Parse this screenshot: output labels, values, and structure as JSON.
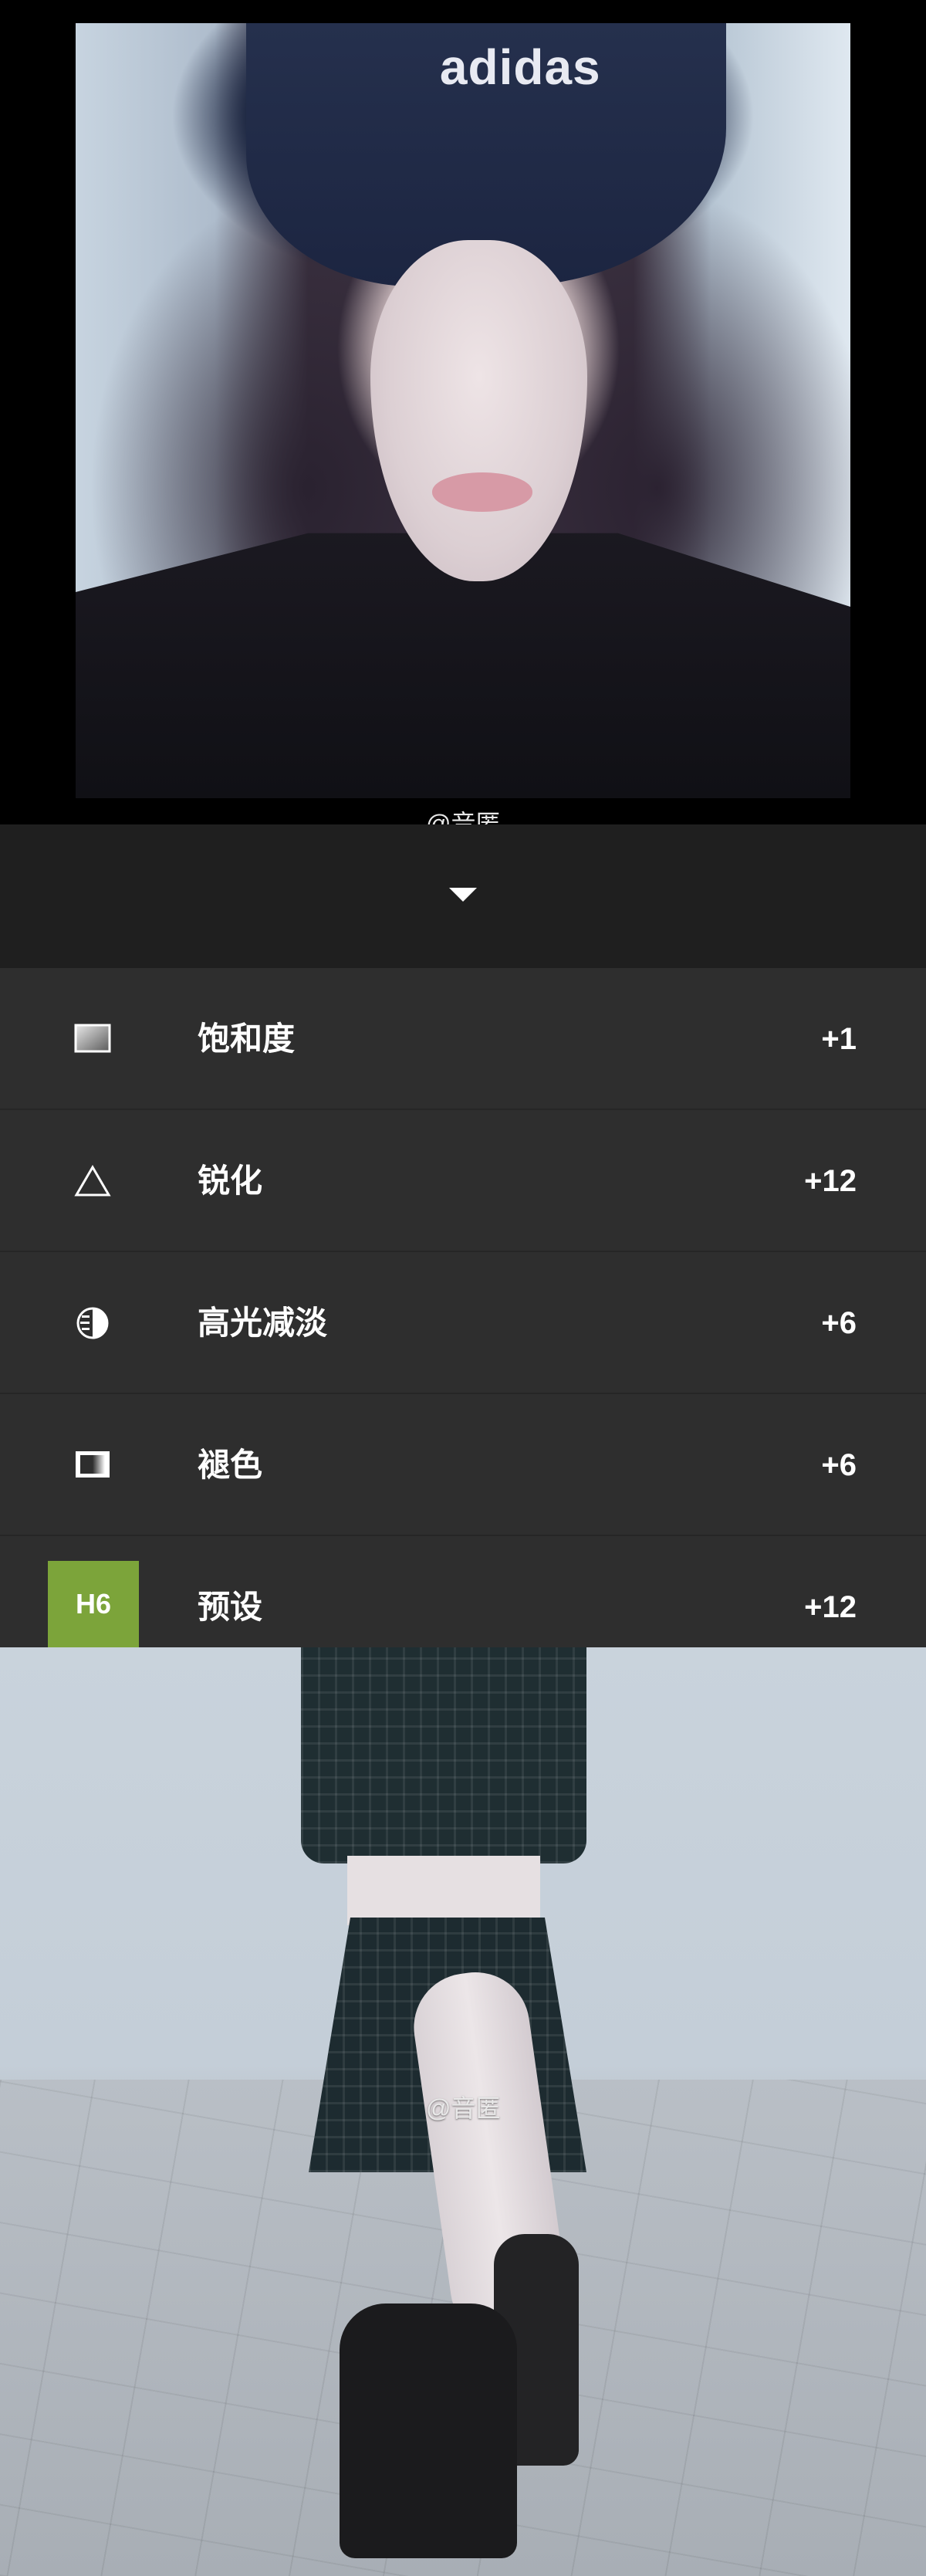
{
  "top_photo": {
    "cap_text": "adidas",
    "watermark": "@音匿"
  },
  "panel": {
    "collapse_icon": "chevron-down-icon",
    "items": [
      {
        "icon": "saturation-icon",
        "label": "饱和度",
        "value": "+1"
      },
      {
        "icon": "sharpen-icon",
        "label": "锐化",
        "value": "+12"
      },
      {
        "icon": "highlight-icon",
        "label": "高光减淡",
        "value": "+6"
      },
      {
        "icon": "fade-icon",
        "label": "褪色",
        "value": "+6"
      },
      {
        "icon": "preset-badge",
        "badge": "H6",
        "label": "预设",
        "value": "+12"
      }
    ]
  },
  "bottom_photo": {
    "watermark": "@音匿"
  },
  "colors": {
    "background": "#000000",
    "panel_header": "#1f1f1f",
    "panel_row": "#2e2e2e",
    "preset_badge": "#7ca43a",
    "text": "#ffffff"
  }
}
